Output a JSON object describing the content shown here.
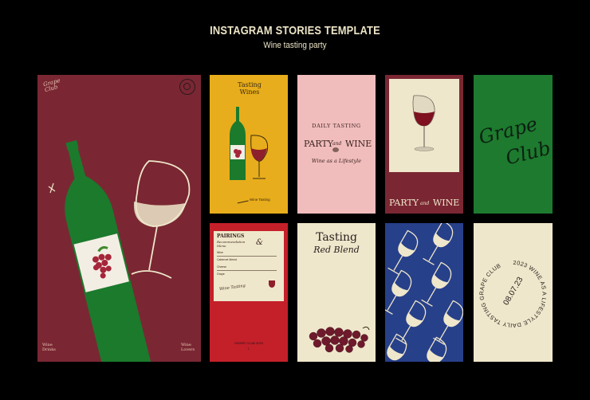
{
  "header": {
    "title": "INSTAGRAM STORIES TEMPLATE",
    "subtitle": "Wine tasting party"
  },
  "colors": {
    "background": "#000000",
    "burgundy": "#7a2733",
    "mustard": "#e8ad1c",
    "pink": "#f1bcbc",
    "cream": "#efe7cb",
    "green": "#1d7a2e",
    "red": "#c4202a",
    "navy": "#27408a"
  },
  "card1": {
    "topleft": "Grape Club",
    "bottomleft": "Wine Drinks",
    "bottomright": "Wine Lovers"
  },
  "card2": {
    "heading": "Tasting Wines",
    "footer": "Wine Tasting"
  },
  "card3": {
    "arc": "DAILY TASTING",
    "left": "PARTY",
    "amp": "and",
    "right": "WINE",
    "tagline": "Wine as a Lifestyle"
  },
  "card4": {
    "left": "PARTY",
    "amp": "and",
    "right": "WINE"
  },
  "card5": {
    "line1": "Grape",
    "line2": "Club"
  },
  "card6": {
    "heading": "PAIRINGS",
    "subheading": "Recommendation Menu",
    "amp": "&",
    "rows": [
      "Wine",
      "Cabernet Merlot",
      "Cheese",
      "Grape"
    ],
    "signature": "Wine Tasting",
    "footer": "GRAPE CLUB 2023"
  },
  "card7": {
    "line1": "Tasting",
    "line2": "Red Blend"
  },
  "card10": {
    "ring": "2023 WINE AS A LIFESTYLE DAILY TASTING GRAPE CLUB ",
    "date": "08.07.23"
  }
}
